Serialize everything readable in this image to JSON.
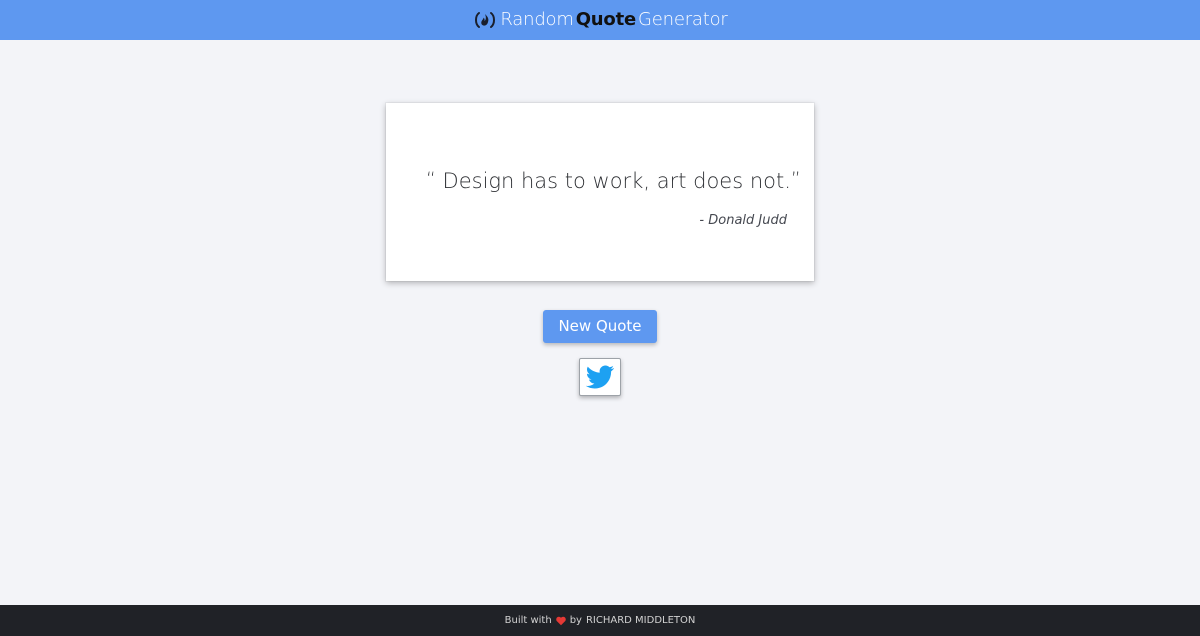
{
  "header": {
    "title_parts": {
      "random": "Random",
      "quote": "Quote",
      "generator": "Generator"
    },
    "logo_icon": "freecodecamp-flame-icon",
    "background_color": "#5e98f0"
  },
  "quote_card": {
    "open_quote": "“",
    "text": "Design has to work, art does not.",
    "close_quote": "”",
    "author": "- Donald Judd"
  },
  "actions": {
    "new_quote_label": "New Quote",
    "tweet_icon": "twitter-bird-icon",
    "accent_color": "#5e98f0",
    "twitter_color": "#1da1f2"
  },
  "footer": {
    "built_with": "Built with",
    "heart_icon": "heart-icon",
    "by": "by",
    "author": "RICHARD MIDDLETON",
    "background_color": "#202227",
    "heart_color": "#e53935"
  }
}
